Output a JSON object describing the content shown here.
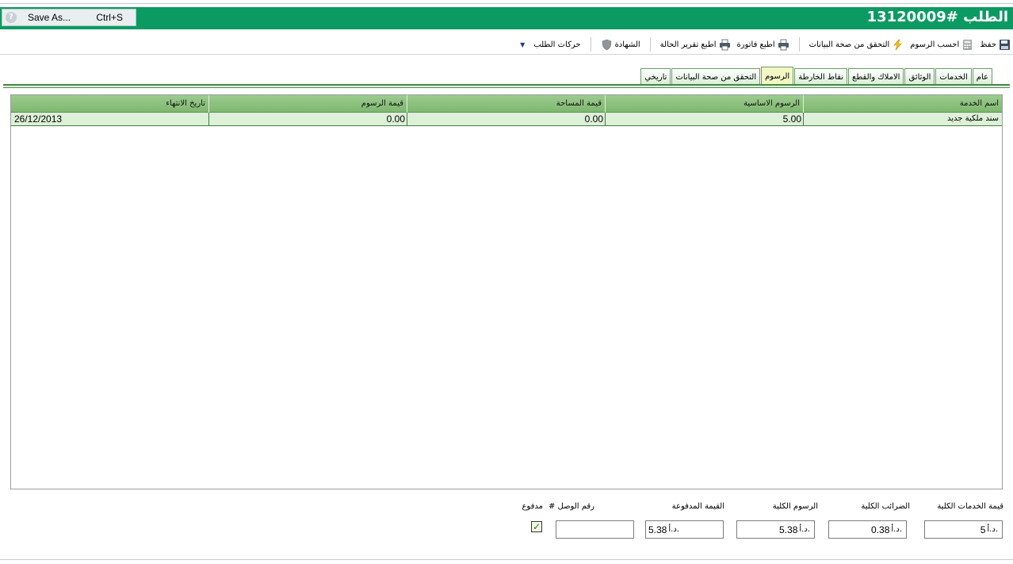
{
  "header": {
    "title": "الطلب #13120009",
    "save_as_label": "Save As...",
    "save_as_shortcut": "Ctrl+S",
    "help_glyph": "?"
  },
  "toolbar": {
    "save": "حفظ",
    "calculate_fees": "احسب الرسوم",
    "validate_data": "التحقق من صحة البيانات",
    "print_invoice": "اطبع فاتورة",
    "print_status_report": "اطبع تقرير الحالة",
    "certificate": "الشهادة",
    "request_actions": "حركات الطلب"
  },
  "tabs": [
    {
      "label": "عام",
      "active": false
    },
    {
      "label": "الخدمات",
      "active": false
    },
    {
      "label": "الوثائق",
      "active": false
    },
    {
      "label": "الاملاك والقطع",
      "active": false
    },
    {
      "label": "نقاط الخارطة",
      "active": false
    },
    {
      "label": "الرسوم",
      "active": true
    },
    {
      "label": "التحقق من صحة البيانات",
      "active": false
    },
    {
      "label": "تاريخي",
      "active": false
    }
  ],
  "grid": {
    "columns": [
      "اسم الخدمة",
      "الرسوم الاساسية",
      "قيمة المساحة",
      "قيمة الرسوم",
      "تاريخ الانتهاء"
    ],
    "rows": [
      {
        "service_name": "سند ملكية جديد",
        "base_fee": "5.00",
        "area_value": "0.00",
        "fee_value": "0.00",
        "expiry_date": "26/12/2013"
      }
    ]
  },
  "summary": {
    "total_services_label": "قيمة الخدمات الكلية",
    "total_services_value": "5",
    "total_taxes_label": "الضرائب الكلية",
    "total_taxes_value": "0.38",
    "total_fees_label": "الرسوم الكلية",
    "total_fees_value": "5.38",
    "paid_amount_label": "القيمة المدفوعة",
    "paid_amount_value": "5.38",
    "receipt_no_label": "رقم الوصل #",
    "receipt_no_value": "",
    "paid_label": "مدفوع",
    "paid_checked": true,
    "currency": "د.أ."
  },
  "colors": {
    "header_bg": "#0b9b62",
    "grid_header": "#8fc37f",
    "row_selected": "#ddf0d8",
    "active_tab": "#f2f7c4"
  }
}
